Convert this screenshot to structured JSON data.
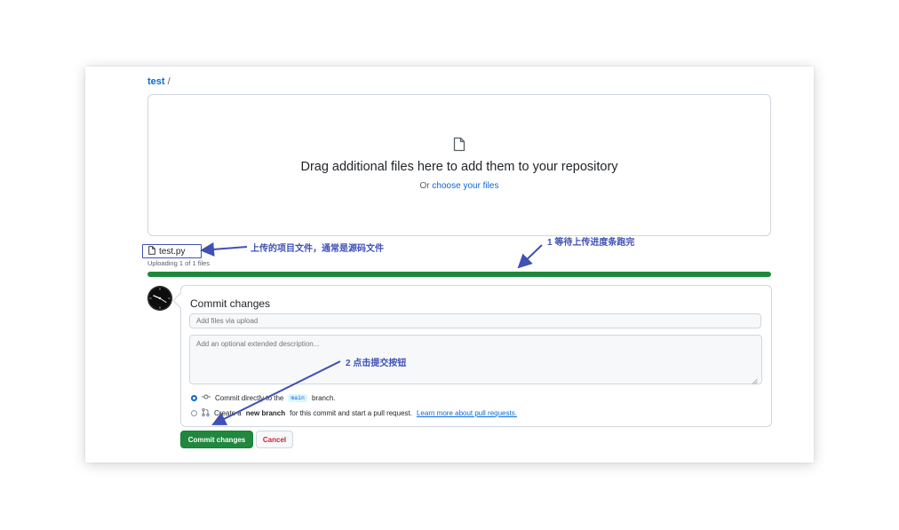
{
  "breadcrumb": {
    "repo": "test",
    "separator": "/"
  },
  "dropzone": {
    "icon": "file-icon",
    "title": "Drag additional files here to add them to your repository",
    "subtitle_prefix": "Or",
    "subtitle_link": "choose your files"
  },
  "upload": {
    "file_icon": "file-icon",
    "file_name": "test.py",
    "status": "Uploading 1 of 1 files",
    "progress_percent": 100,
    "progress_color": "#1f883d"
  },
  "commit": {
    "avatar_icon": "clock-avatar",
    "title": "Commit changes",
    "summary_placeholder": "Add files via upload",
    "description_placeholder": "Add an optional extended description...",
    "option_direct": {
      "icon": "git-commit-icon",
      "prefix": "Commit directly to the",
      "branch": "main",
      "suffix": "branch.",
      "checked": true
    },
    "option_pr": {
      "icon": "git-pull-request-icon",
      "prefix": "Create a",
      "bold": "new branch",
      "middle": "for this commit and start a pull request.",
      "link": "Learn more about pull requests.",
      "checked": false
    },
    "submit_label": "Commit changes",
    "cancel_label": "Cancel"
  },
  "annotations": {
    "color": "#3f51b5",
    "file_note": "上传的项目文件，通常是源码文件",
    "step1": "1 等待上传进度条跑完",
    "step2": "2 点击提交按钮"
  }
}
